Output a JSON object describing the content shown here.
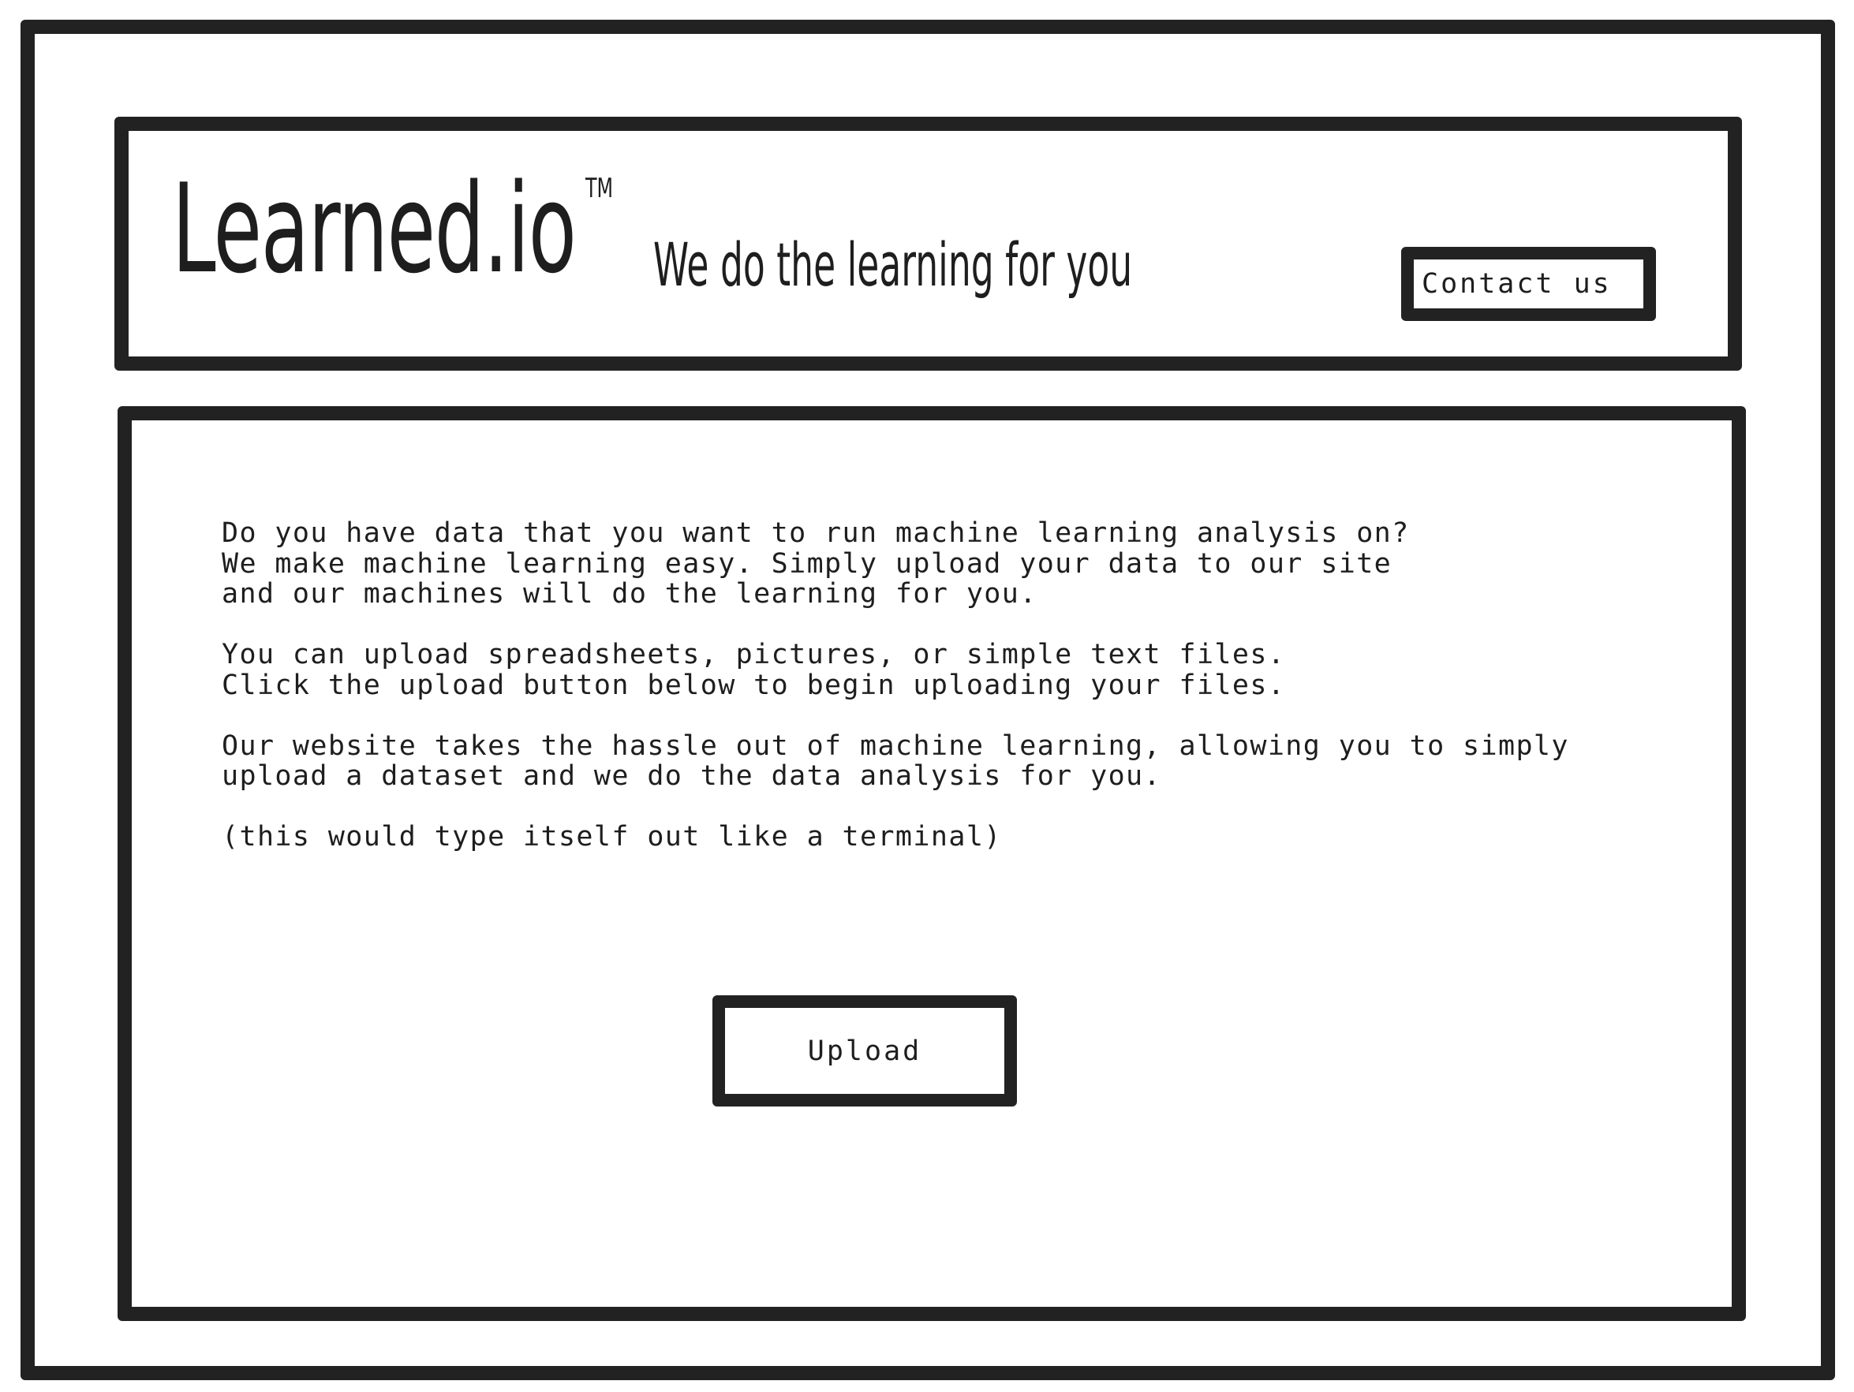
{
  "header": {
    "logo": "Learned.io",
    "trademark": "TM",
    "tagline": "We do the learning for you",
    "contact_label": "Contact us"
  },
  "main": {
    "paragraphs": [
      {
        "lines": [
          "Do you have data that you want to run machine learning analysis on?",
          "We make machine learning easy. Simply upload your data to our site",
          "and our machines will do the learning for you."
        ]
      },
      {
        "lines": [
          "You can upload spreadsheets, pictures, or simple text files.",
          "Click the upload button below to begin uploading your files."
        ]
      },
      {
        "lines": [
          "Our website takes the hassle out of machine learning, allowing you to simply",
          "upload a dataset and we do the data analysis for you."
        ]
      },
      {
        "lines": [
          "(this would type itself out like a terminal)"
        ]
      }
    ],
    "upload_label": "Upload"
  }
}
